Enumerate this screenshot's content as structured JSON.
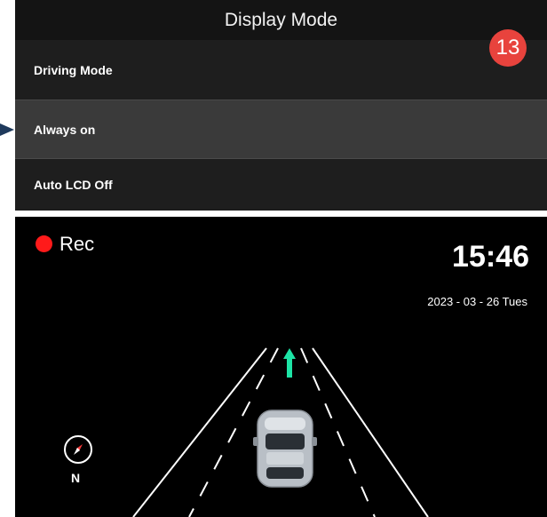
{
  "menu": {
    "title": "Display Mode",
    "step_badge": "13",
    "items": [
      {
        "label": "Driving Mode",
        "selected": false
      },
      {
        "label": "Always on",
        "selected": true
      },
      {
        "label": "Auto LCD Off",
        "selected": false
      }
    ]
  },
  "dash": {
    "rec_label": "Rec",
    "time": "15:46",
    "date": "2023 - 03 - 26  Tues",
    "compass_heading": "N"
  },
  "colors": {
    "badge": "#e8433d",
    "rec_dot": "#ff1a1a",
    "nav_arrow": "#1de4a6",
    "pointer_arrow": "#1f3a5c"
  },
  "icons": [
    "pointer-arrow-icon",
    "compass-icon",
    "navigation-arrow-icon",
    "car-icon"
  ]
}
